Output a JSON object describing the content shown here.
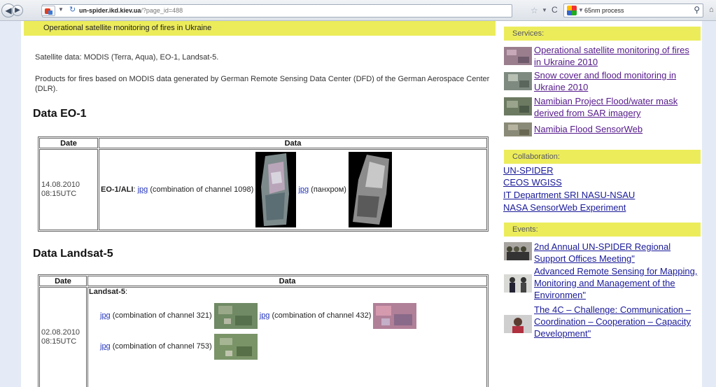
{
  "browser": {
    "url_host": "un-spider.ikd.kiev.ua",
    "url_path": "/?page_id=488",
    "search_value": "65nm process"
  },
  "main": {
    "banner": "Operational satellite monitoring of fires in Ukraine",
    "satellite_data": "Satellite data: MODIS (Terra, Aqua), EO-1, Landsat-5.",
    "products_text": "Products for fires based on MODIS data generated by German Remote Sensing Data Center (DFD) of the German Aerospace Center (DLR).",
    "eo1": {
      "heading": "Data EO-1",
      "col_date": "Date",
      "col_data": "Data",
      "date": "14.08.2010",
      "time": "08:15UTC",
      "label": "EO-1/ALI",
      "link1": "jpg",
      "text1": " (combination of channel 1098)",
      "link2": "jpg",
      "text2": " (панхром)"
    },
    "landsat": {
      "heading": "Data Landsat-5",
      "col_date": "Date",
      "col_data": "Data",
      "date": "02.08.2010",
      "time": "08:15UTC",
      "label": "Landsat-5",
      "label_suffix": ":",
      "link1": "jpg",
      "text1": " (combination of channel 321)",
      "link2": "jpg",
      "text2": " (combination of channel 432)",
      "link3": "jpg",
      "text3": " (combination of channel 753)"
    }
  },
  "sidebar": {
    "services_header": "Services:",
    "services": [
      "Operational satellite monitoring of fires in Ukraine 2010",
      "Snow cover and flood monitoring in Ukraine 2010",
      "Namibian Project Flood/water mask derived from SAR imagery",
      "Namibia Flood SensorWeb"
    ],
    "collab_header": "Collaboration:",
    "collab": [
      "UN-SPIDER",
      "CEOS WGISS",
      "IT Department SRI NASU-NSAU",
      "NASA SensorWeb Experiment"
    ],
    "events_header": "Events:",
    "events": [
      "2nd Annual UN-SPIDER Regional Support Offices Meeting\"",
      "Advanced Remote Sensing for Mapping, Monitoring and Management of the Environmen\"",
      "The 4C – Challenge: Communication – Coordination – Cooperation – Capacity Development\""
    ]
  }
}
